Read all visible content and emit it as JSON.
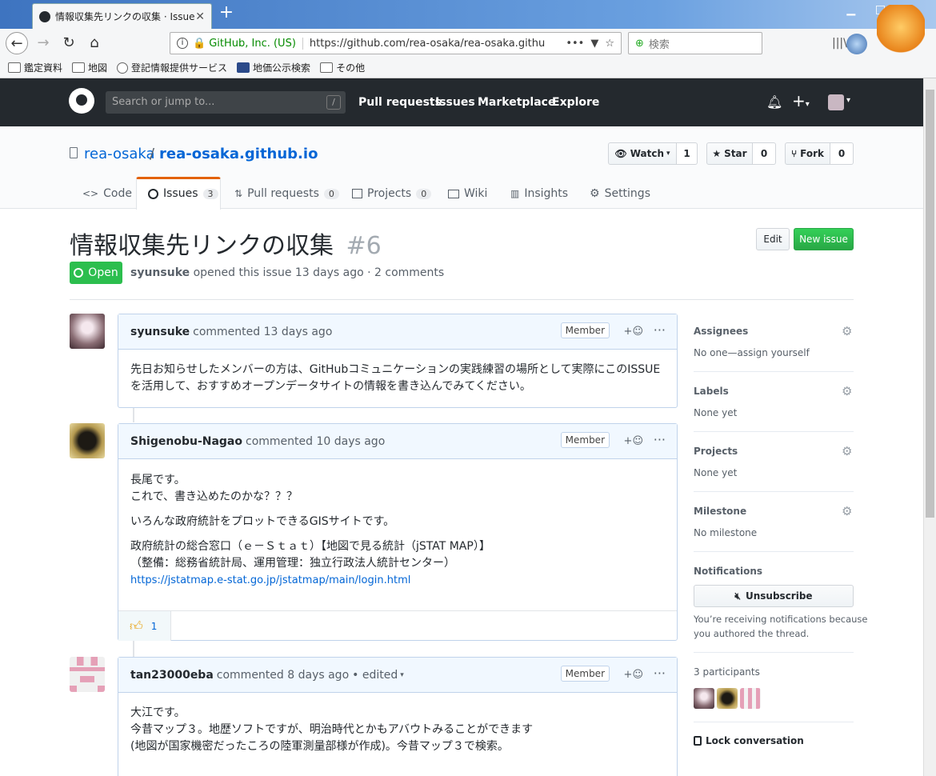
{
  "browser": {
    "tab_title": "情報収集先リンクの収集 · Issue",
    "site_identity": "GitHub, Inc. (US)",
    "url": "https://github.com/rea-osaka/rea-osaka.githu",
    "search_placeholder": "検索",
    "bookmarks": [
      "鑑定資料",
      "地図",
      "登記情報提供サービス",
      "地価公示検索",
      "その他"
    ]
  },
  "github": {
    "search_placeholder": "Search or jump to...",
    "search_key": "/",
    "nav": [
      "Pull requests",
      "Issues",
      "Marketplace",
      "Explore"
    ]
  },
  "repo": {
    "owner": "rea-osaka",
    "separator": "/",
    "name": "rea-osaka.github.io",
    "watch_label": "Watch",
    "watch_count": "1",
    "star_label": "Star",
    "star_count": "0",
    "fork_label": "Fork",
    "fork_count": "0",
    "tabs": [
      {
        "label": "Code",
        "count": ""
      },
      {
        "label": "Issues",
        "count": "3"
      },
      {
        "label": "Pull requests",
        "count": "0"
      },
      {
        "label": "Projects",
        "count": "0"
      },
      {
        "label": "Wiki",
        "count": ""
      },
      {
        "label": "Insights",
        "count": ""
      },
      {
        "label": "Settings",
        "count": ""
      }
    ]
  },
  "issue": {
    "title": "情報収集先リンクの収集",
    "number": "#6",
    "state": "Open",
    "author": "syunsuke",
    "meta": "opened this issue 13 days ago · 2 comments",
    "edit_label": "Edit",
    "new_issue_label": "New issue"
  },
  "comments": [
    {
      "author": "syunsuke",
      "meta": "commented 13 days ago",
      "badge": "Member",
      "lines": [
        "先日お知らせしたメンバーの方は、GitHubコミュニケーションの実践練習の場所として実際にこのISSUEを活用して、おすすめオープンデータサイトの情報を書き込んでみてください。"
      ]
    },
    {
      "author": "Shigenobu-Nagao",
      "meta": "commented 10 days ago",
      "badge": "Member",
      "p1": [
        "長尾です。",
        "これで、書き込めたのかな？？？"
      ],
      "p2": "いろんな政府統計をプロットできるGISサイトです。",
      "p3": [
        "政府統計の総合窓口（ｅ－Ｓｔａｔ）【地図で見る統計（jSTAT MAP）】",
        "（整備：総務省統計局、運用管理：独立行政法人統計センター）"
      ],
      "link": "https://jstatmap.e-stat.go.jp/jstatmap/main/login.html",
      "reaction_count": "1"
    },
    {
      "author": "tan23000eba",
      "meta": "commented 8 days ago",
      "edited": "• edited",
      "badge": "Member",
      "lines": [
        "大江です。",
        "今昔マップ３。地歴ソフトですが、明治時代とかもアバウトみることができます",
        "(地図が国家機密だったころの陸軍測量部様が作成)。今昔マップ３で検索。"
      ]
    }
  ],
  "sidebar": {
    "assignees_h": "Assignees",
    "assignees_v": "No one—assign yourself",
    "labels_h": "Labels",
    "labels_v": "None yet",
    "projects_h": "Projects",
    "projects_v": "None yet",
    "milestone_h": "Milestone",
    "milestone_v": "No milestone",
    "notifications_h": "Notifications",
    "unsubscribe": "Unsubscribe",
    "notif_note_1": "You’re receiving notifications because",
    "notif_note_2": "you authored the thread.",
    "participants": "3 participants",
    "lock": "Lock conversation"
  },
  "colors": {
    "open_green": "#2cbe4e",
    "link_blue": "#0366d6",
    "header_dark": "#24292e"
  }
}
